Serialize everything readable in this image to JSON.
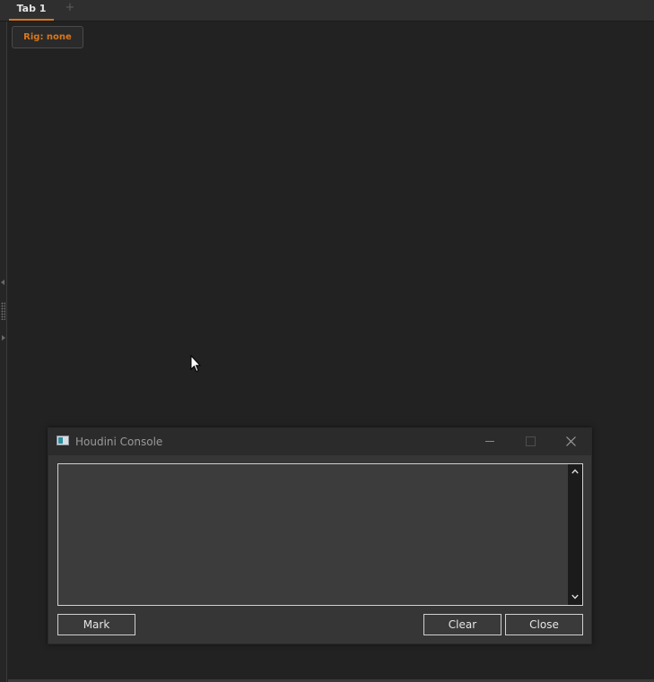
{
  "tabs": {
    "active_label": "Tab 1",
    "add_label": "+"
  },
  "main": {
    "rig_label": "Rig: none"
  },
  "console": {
    "title": "Houdini Console",
    "output": "",
    "buttons": {
      "mark": "Mark",
      "clear": "Clear",
      "close": "Close"
    }
  },
  "colors": {
    "accent": "#d8771c",
    "background": "#222222",
    "dialog_background": "#363636",
    "console_background": "#3c3c3c"
  },
  "icons": {
    "app_icon": "houdini-console-icon",
    "minimize": "minimize-icon",
    "maximize": "maximize-icon",
    "close": "close-icon",
    "scroll_up": "chevron-up-icon",
    "scroll_down": "chevron-down-icon",
    "cursor": "mouse-pointer-icon"
  }
}
